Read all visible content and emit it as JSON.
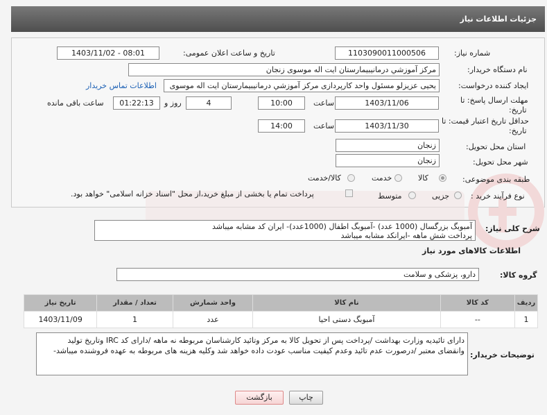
{
  "header": {
    "title": "جزئیات اطلاعات نیاز"
  },
  "fields": {
    "need_number_label": "شماره نیاز:",
    "need_number": "1103090011000506",
    "announce_label": "تاریخ و ساعت اعلان عمومی:",
    "announce_value": "1403/11/02 - 08:01",
    "buyer_org_label": "نام دستگاه خریدار:",
    "buyer_org": "مرکز آموزشي درمانیبیمارستان ایت اله موسوی زنجان",
    "requester_label": "ایجاد کننده درخواست:",
    "requester": "یحیی عزیزلو مسئول واحد کارپردازی مرکز آموزشي درمانیبیمارستان ایت اله موسوی",
    "contact_link": "اطلاعات تماس خریدار",
    "deadline_label_1": "مهلت ارسال پاسخ: تا",
    "deadline_label_2": "تاریخ:",
    "deadline_date": "1403/11/06",
    "time_label": "ساعت",
    "deadline_time": "10:00",
    "days_value": "4",
    "days_label": "روز و",
    "remaining_time": "01:22:13",
    "remaining_label": "ساعت باقی مانده",
    "price_valid_label_1": "حداقل تاریخ اعتبار قیمت: تا",
    "price_valid_label_2": "تاریخ:",
    "price_valid_date": "1403/11/30",
    "price_valid_time": "14:00",
    "province_label": "استان محل تحویل:",
    "province": "زنجان",
    "city_label": "شهر محل تحویل:",
    "city": "زنجان",
    "category_label": "طبقه بندی موضوعی:",
    "category_options": [
      "کالا",
      "خدمت",
      "کالا/خدمت"
    ],
    "process_label": "نوع فرآیند خرید :",
    "process_options": [
      "جزیی",
      "متوسط"
    ],
    "payment_note": "پرداخت تمام یا بخشی از مبلغ خرید،از محل \"اسناد خزانه اسلامی\" خواهد بود."
  },
  "summary": {
    "label": "شرح کلی نیاز:",
    "line1": "آمبوبگ بزرگسال (1000 عدد) -آمبوبگ اطفال (1000عدد)- ایران کد مشابه میباشد",
    "line2": "پرداخت شش ماهه -ایرانکد مشابه میباشد"
  },
  "goods": {
    "section_title": "اطلاعات کالاهای مورد نیاز",
    "group_label": "گروه کالا:",
    "group_value": "دارو، پزشکی و سلامت"
  },
  "table": {
    "headers": [
      "ردیف",
      "کد کالا",
      "نام کالا",
      "واحد شمارش",
      "تعداد / مقدار",
      "تاریخ نیاز"
    ],
    "rows": [
      [
        "1",
        "--",
        "آمبوبگ دستی احیا",
        "عدد",
        "1",
        "1403/11/09"
      ]
    ]
  },
  "buyer_notes": {
    "label": "توضیحات خریدار:",
    "text": "دارای تائیدیه وزارت بهداشت  /پرداخت پس از تحویل کالا به مرکز وتائید کارشناسان مربوطه نه ماهه  /دارای کد IRC  وتاریخ تولید وانقضای معتبر /درصورت عدم تائید وعدم کیفیت مناسب عودت داده خواهد شد وکلیه هزینه های مربوطه به عهده فروشنده میباشد-"
  },
  "buttons": {
    "print": "چاپ",
    "back": "بازگشت"
  }
}
